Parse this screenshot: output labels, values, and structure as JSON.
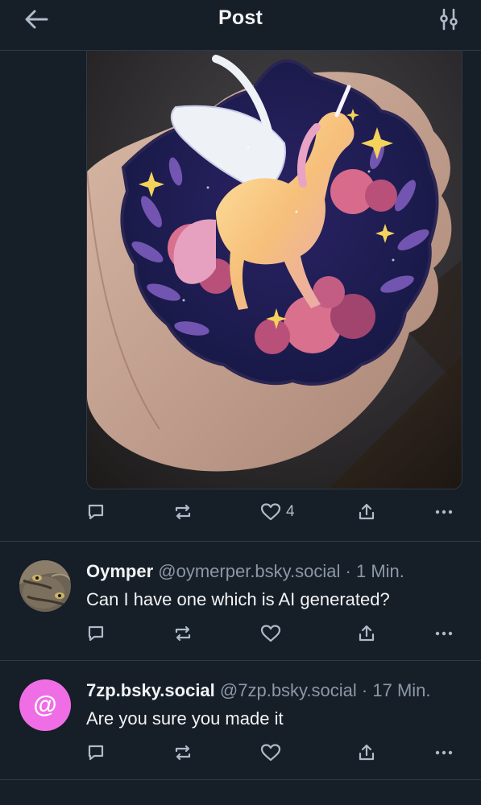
{
  "header": {
    "title": "Post",
    "back_icon": "arrow-left-icon",
    "filter_icon": "sliders-icon"
  },
  "post": {
    "image_alt": "Holographic sticker of a winged unicorn among roses held in a hand",
    "actions": {
      "reply_count": "",
      "repost_count": "",
      "like_count": "4"
    }
  },
  "replies": [
    {
      "display_name": "Oymper",
      "handle": "@oymerper.bsky.social",
      "time": "· 1 Min.",
      "text": "Can I have one which is AI generated?",
      "avatar": "cat-photo-avatar"
    },
    {
      "display_name": "7zp.bsky.social",
      "handle": "@7zp.bsky.social",
      "time": "· 17 Min.",
      "text": "Are you sure you made it",
      "avatar_symbol": "@",
      "avatar_color": "#ef6ee6"
    }
  ],
  "colors": {
    "background": "#161e27",
    "border": "#2e3a48",
    "muted_text": "#8b98a8",
    "icon": "#aebbc9"
  }
}
